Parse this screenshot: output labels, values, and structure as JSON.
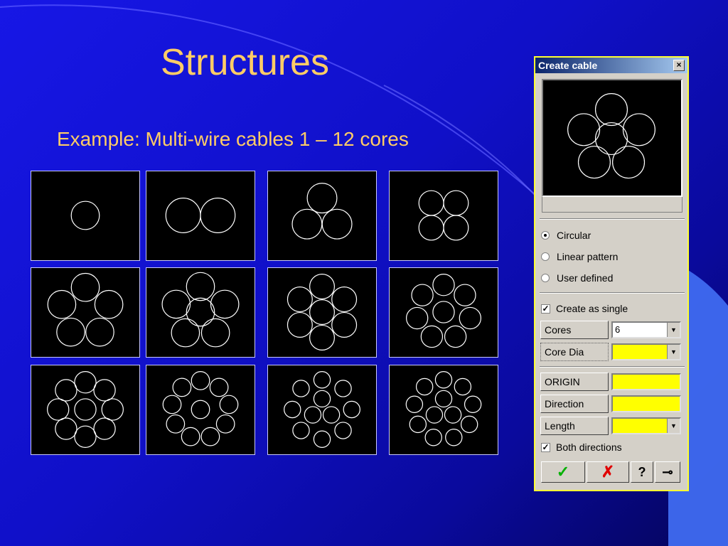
{
  "slide": {
    "title": "Structures",
    "subtitle": "Example: Multi-wire cables 1 – 12 cores"
  },
  "thumbnails": [
    {
      "cores": 1
    },
    {
      "cores": 2
    },
    {
      "cores": 3
    },
    {
      "cores": 4
    },
    {
      "cores": 5
    },
    {
      "cores": 6
    },
    {
      "cores": 7
    },
    {
      "cores": 8
    },
    {
      "cores": 9
    },
    {
      "cores": 10
    },
    {
      "cores": 11
    },
    {
      "cores": 12
    }
  ],
  "dialog": {
    "title": "Create cable",
    "close_icon": "×",
    "pattern_options": [
      "Circular",
      "Linear pattern",
      "User defined"
    ],
    "selected_pattern": "Circular",
    "create_as_single": "Create as single",
    "create_as_single_checked": true,
    "cores_label": "Cores",
    "cores_value": "6",
    "core_dia_label": "Core Dia",
    "core_dia_value": "",
    "origin_label": "ORIGIN",
    "direction_label": "Direction",
    "length_label": "Length",
    "both_directions": "Both directions",
    "both_directions_checked": true,
    "ok_icon": "✓",
    "cancel_icon": "✗",
    "help_icon": "?",
    "pin_icon": "⊸"
  },
  "colors": {
    "title_text": "#ffcc66",
    "wire": "#ffffff",
    "input_highlight": "#ffff00",
    "ok_green": "#00b000",
    "cancel_red": "#e00000"
  }
}
